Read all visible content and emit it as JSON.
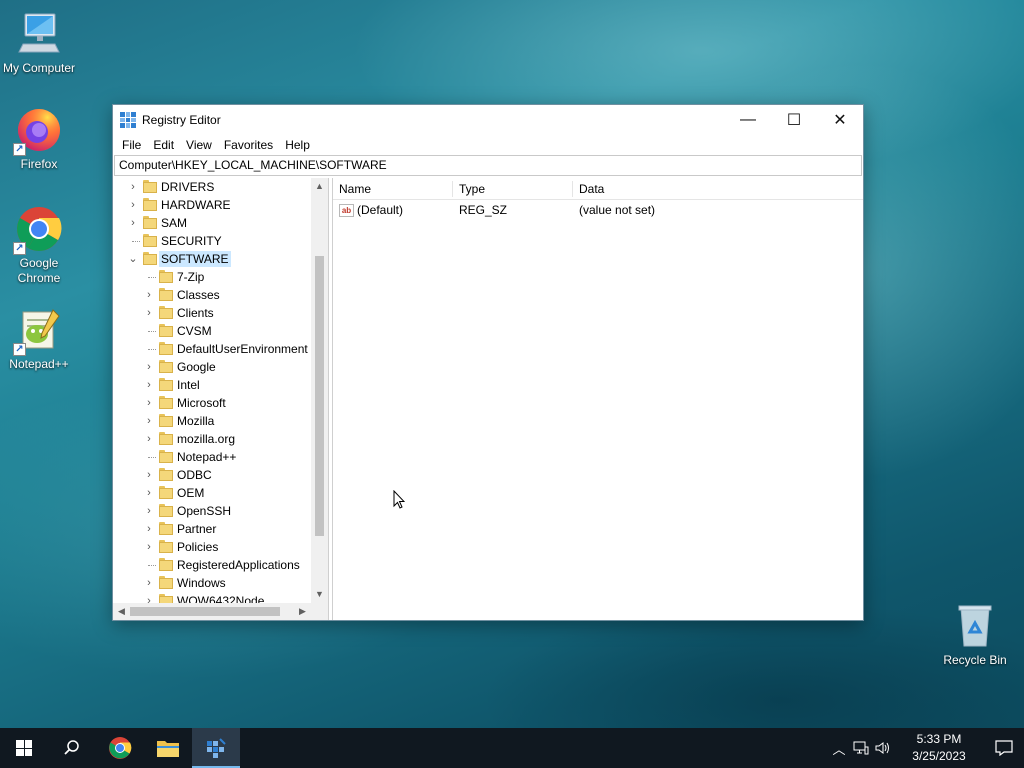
{
  "desktop": {
    "icons": [
      {
        "label": "My Computer"
      },
      {
        "label": "Firefox"
      },
      {
        "label": "Google Chrome"
      },
      {
        "label": "Notepad++"
      },
      {
        "label": "Recycle Bin"
      }
    ]
  },
  "window": {
    "title": "Registry Editor",
    "controls": {
      "minimize": "—",
      "maximize": "☐",
      "close": "✕"
    },
    "menu": [
      "File",
      "Edit",
      "View",
      "Favorites",
      "Help"
    ],
    "address": "Computer\\HKEY_LOCAL_MACHINE\\SOFTWARE",
    "tree": [
      {
        "label": "DRIVERS",
        "level": 0,
        "expandable": true
      },
      {
        "label": "HARDWARE",
        "level": 0,
        "expandable": true
      },
      {
        "label": "SAM",
        "level": 0,
        "expandable": true
      },
      {
        "label": "SECURITY",
        "level": 0,
        "expandable": false
      },
      {
        "label": "SOFTWARE",
        "level": 0,
        "expandable": true,
        "expanded": true,
        "selected": true
      },
      {
        "label": "7-Zip",
        "level": 1,
        "expandable": false
      },
      {
        "label": "Classes",
        "level": 1,
        "expandable": true
      },
      {
        "label": "Clients",
        "level": 1,
        "expandable": true
      },
      {
        "label": "CVSM",
        "level": 1,
        "expandable": false
      },
      {
        "label": "DefaultUserEnvironment",
        "level": 1,
        "expandable": false
      },
      {
        "label": "Google",
        "level": 1,
        "expandable": true
      },
      {
        "label": "Intel",
        "level": 1,
        "expandable": true
      },
      {
        "label": "Microsoft",
        "level": 1,
        "expandable": true
      },
      {
        "label": "Mozilla",
        "level": 1,
        "expandable": true
      },
      {
        "label": "mozilla.org",
        "level": 1,
        "expandable": true
      },
      {
        "label": "Notepad++",
        "level": 1,
        "expandable": false
      },
      {
        "label": "ODBC",
        "level": 1,
        "expandable": true
      },
      {
        "label": "OEM",
        "level": 1,
        "expandable": true
      },
      {
        "label": "OpenSSH",
        "level": 1,
        "expandable": true
      },
      {
        "label": "Partner",
        "level": 1,
        "expandable": true
      },
      {
        "label": "Policies",
        "level": 1,
        "expandable": true
      },
      {
        "label": "RegisteredApplications",
        "level": 1,
        "expandable": false
      },
      {
        "label": "Windows",
        "level": 1,
        "expandable": true
      },
      {
        "label": "WOW6432Node",
        "level": 1,
        "expandable": true
      }
    ],
    "list": {
      "columns": [
        "Name",
        "Type",
        "Data"
      ],
      "rows": [
        {
          "icon": "ab",
          "name": "(Default)",
          "type": "REG_SZ",
          "data": "(value not set)"
        }
      ]
    }
  },
  "taskbar": {
    "time": "5:33 PM",
    "date": "3/25/2023"
  },
  "colors": {
    "selection": "#cce8ff",
    "taskbar": "#101820",
    "folder": "#f4d77a"
  }
}
